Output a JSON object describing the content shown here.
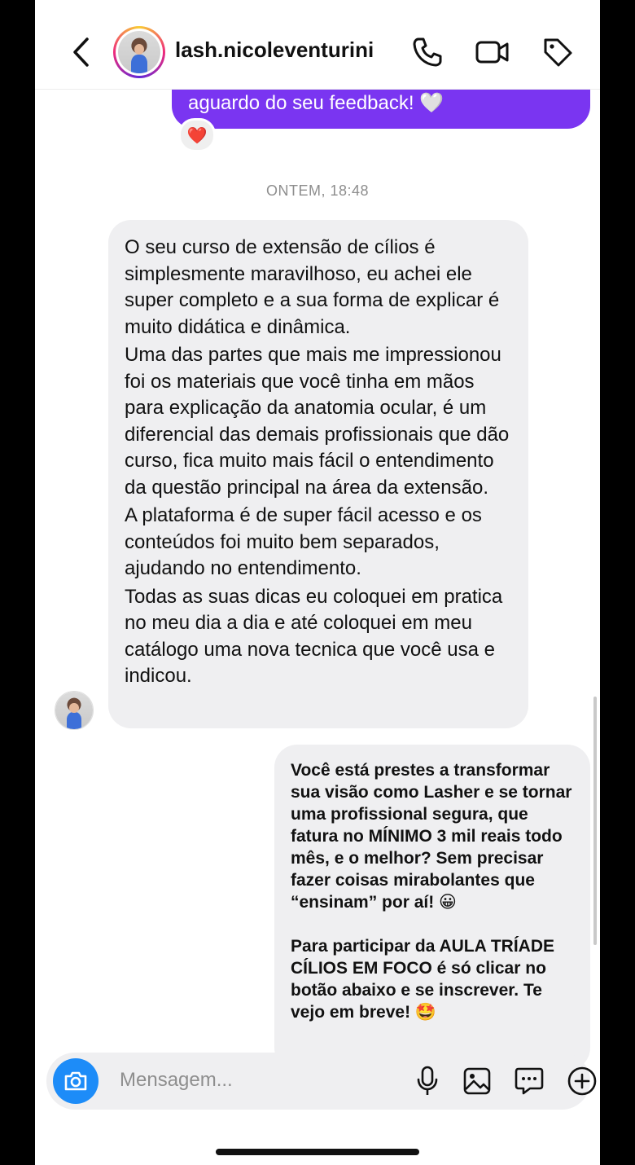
{
  "header": {
    "username": "lash.nicoleventurini"
  },
  "icons": {
    "back": "chevron-left-icon",
    "phone": "phone-icon",
    "video": "video-camera-icon",
    "tag": "tag-icon",
    "camera": "camera-icon",
    "mic": "microphone-icon",
    "gallery": "image-icon",
    "sticker": "chat-bubble-icon",
    "add": "plus-circle-icon"
  },
  "messages": {
    "outgoing_top": "aguardo do seu feedback! 🤍",
    "reaction": "❤️",
    "timestamp": "ONTEM, 18:48",
    "incoming": [
      "O seu curso de extensão de cílios é simplesmente maravilhoso, eu achei ele super completo e a sua forma de explicar é muito didática e dinâmica.",
      "Uma das partes que mais me impressionou foi os materiais que você tinha em mãos para explicação da anatomia ocular, é um diferencial das demais profissionais que dão curso, fica muito mais fácil o entendimento da questão principal na área da extensão.",
      "A plataforma é de super fácil acesso e os conteúdos foi muito bem separados, ajudando no entendimento.",
      "Todas as suas dicas eu coloquei em pratica no meu dia a dia e até coloquei em meu catálogo uma nova tecnica que você usa e indicou."
    ],
    "outgoing": [
      "Você está prestes a transformar sua visão como Lasher e se tornar uma profissional segura, que fatura no MÍNIMO 3 mil reais todo mês, e o melhor? Sem precisar fazer coisas mirabolantes que “ensinam” por aí! 😀",
      "Para participar da AULA TRÍADE CÍLIOS EM FOCO é só clicar no botão abaixo e se inscrever. Te vejo em breve! 🤩"
    ]
  },
  "composer": {
    "placeholder": "Mensagem..."
  },
  "colors": {
    "accent_purple": "#7a35f1",
    "camera_blue": "#1d8cf8",
    "bubble_gray": "#efeff1"
  }
}
